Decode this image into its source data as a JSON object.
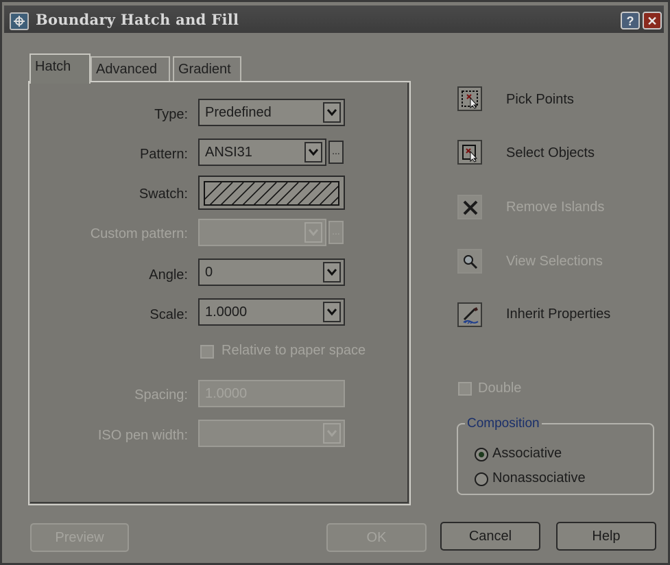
{
  "window": {
    "title": "Boundary Hatch and Fill",
    "help_label": "?",
    "close_label": "✕"
  },
  "tabs": [
    {
      "label": "Hatch",
      "active": true
    },
    {
      "label": "Advanced",
      "active": false
    },
    {
      "label": "Gradient",
      "active": false
    }
  ],
  "hatch": {
    "type": {
      "label": "Type:",
      "value": "Predefined"
    },
    "pattern": {
      "label": "Pattern:",
      "value": "ANSI31",
      "ellipsis": "..."
    },
    "swatch": {
      "label": "Swatch:"
    },
    "custom_pattern": {
      "label": "Custom pattern:",
      "value": "",
      "ellipsis": "...",
      "enabled": false
    },
    "angle": {
      "label": "Angle:",
      "value": "0"
    },
    "scale": {
      "label": "Scale:",
      "value": "1.0000"
    },
    "relative_paper_space": {
      "label": "Relative to paper space",
      "checked": false,
      "enabled": false
    },
    "spacing": {
      "label": "Spacing:",
      "value": "1.0000",
      "enabled": false
    },
    "iso_pen_width": {
      "label": "ISO pen width:",
      "value": "",
      "enabled": false
    }
  },
  "actions": [
    {
      "label": "Pick Points",
      "icon": "pick-points-icon",
      "enabled": true
    },
    {
      "label": "Select Objects",
      "icon": "select-objects-icon",
      "enabled": true
    },
    {
      "label": "Remove Islands",
      "icon": "remove-islands-icon",
      "enabled": false
    },
    {
      "label": "View Selections",
      "icon": "magnifier-icon",
      "enabled": false
    },
    {
      "label": "Inherit Properties",
      "icon": "inherit-properties-icon",
      "enabled": true
    }
  ],
  "double": {
    "label": "Double",
    "checked": false,
    "enabled": false
  },
  "composition": {
    "title": "Composition",
    "options": [
      {
        "label": "Associative",
        "selected": true
      },
      {
        "label": "Nonassociative",
        "selected": false
      }
    ]
  },
  "buttons": {
    "preview": "Preview",
    "ok": "OK",
    "cancel": "Cancel",
    "help": "Help"
  },
  "colors": {
    "dialog_bg": "#7c7b76",
    "title_bar": "#3c3c3c",
    "composition_title": "#1a2f6a"
  }
}
